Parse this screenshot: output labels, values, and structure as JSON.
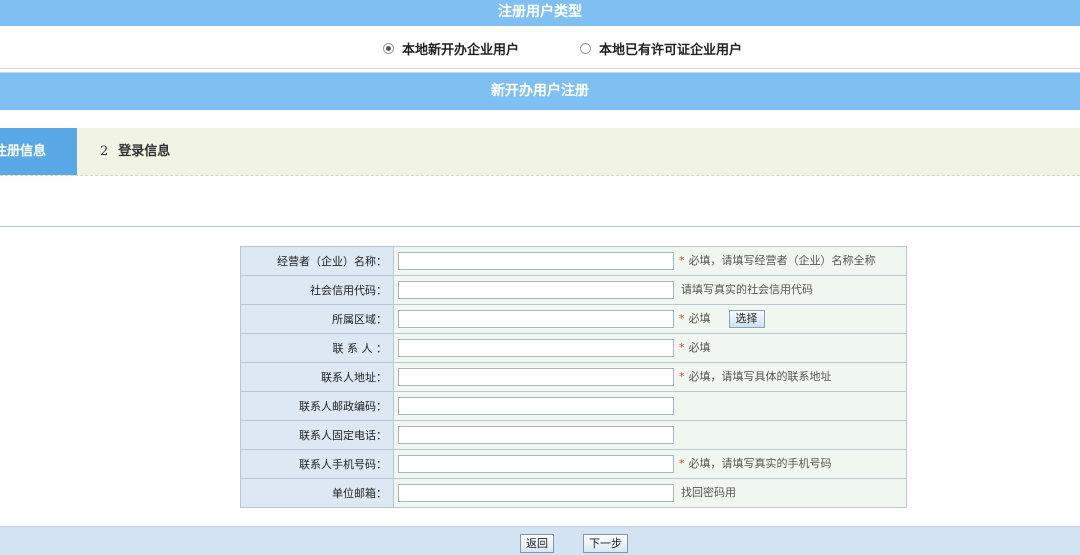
{
  "sections": {
    "user_type_title": "注册用户类型",
    "new_user_title": "新开办用户注册"
  },
  "user_type": {
    "options": [
      {
        "label": "本地新开办企业用户",
        "checked": true
      },
      {
        "label": "本地已有许可证企业用户",
        "checked": false
      }
    ]
  },
  "steps": {
    "step1_label": "注册信息",
    "step2_number": "2",
    "step2_label": "登录信息"
  },
  "form": {
    "rows": [
      {
        "label": "经营者（企业）名称：",
        "value": "",
        "required": "*",
        "hint": "必填，请填写经营者（企业）名称全称"
      },
      {
        "label": "社会信用代码：",
        "value": "",
        "required": "",
        "hint": "请填写真实的社会信用代码"
      },
      {
        "label": "所属区域：",
        "value": "",
        "required": "*",
        "hint": "必填",
        "button": "选择"
      },
      {
        "label": "联 系 人 ：",
        "value": "",
        "required": "*",
        "hint": "必填"
      },
      {
        "label": "联系人地址：",
        "value": "",
        "required": "*",
        "hint": "必填，请填写具体的联系地址"
      },
      {
        "label": "联系人邮政编码：",
        "value": "",
        "required": "",
        "hint": ""
      },
      {
        "label": "联系人固定电话：",
        "value": "",
        "required": "",
        "hint": ""
      },
      {
        "label": "联系人手机号码：",
        "value": "",
        "required": "*",
        "hint": "必填，请填写真实的手机号码"
      },
      {
        "label": "单位邮箱：",
        "value": "",
        "required": "",
        "hint": "找回密码用"
      }
    ]
  },
  "footer": {
    "back_label": "返回",
    "next_label": "下一步"
  },
  "colors": {
    "header_bar": "#7fbff2",
    "active_step": "#5aa9e6",
    "required_star": "#e03c3c"
  }
}
